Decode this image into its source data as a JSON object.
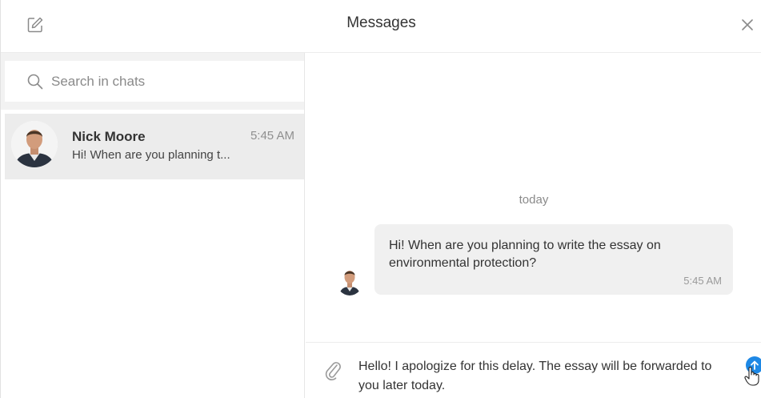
{
  "header": {
    "title": "Messages",
    "compose_icon": "edit-icon",
    "close_icon": "close-icon"
  },
  "search": {
    "placeholder": "Search in chats",
    "icon": "search-icon"
  },
  "chats": [
    {
      "name": "Nick Moore",
      "time": "5:45 AM",
      "preview": "Hi! When are you planning t..."
    }
  ],
  "conversation": {
    "day_label": "today",
    "messages": [
      {
        "text": "Hi! When are you planning to write the essay on environmental protection?",
        "time": "5:45 AM"
      }
    ]
  },
  "composer": {
    "text": "Hello! I apologize for this delay. The essay will be forwarded to you later today.",
    "attach_icon": "paperclip-icon",
    "send_icon": "send-arrow-icon"
  },
  "colors": {
    "accent": "#1e88e5",
    "selected_row": "#ececec",
    "bubble": "#f0f0f0"
  }
}
